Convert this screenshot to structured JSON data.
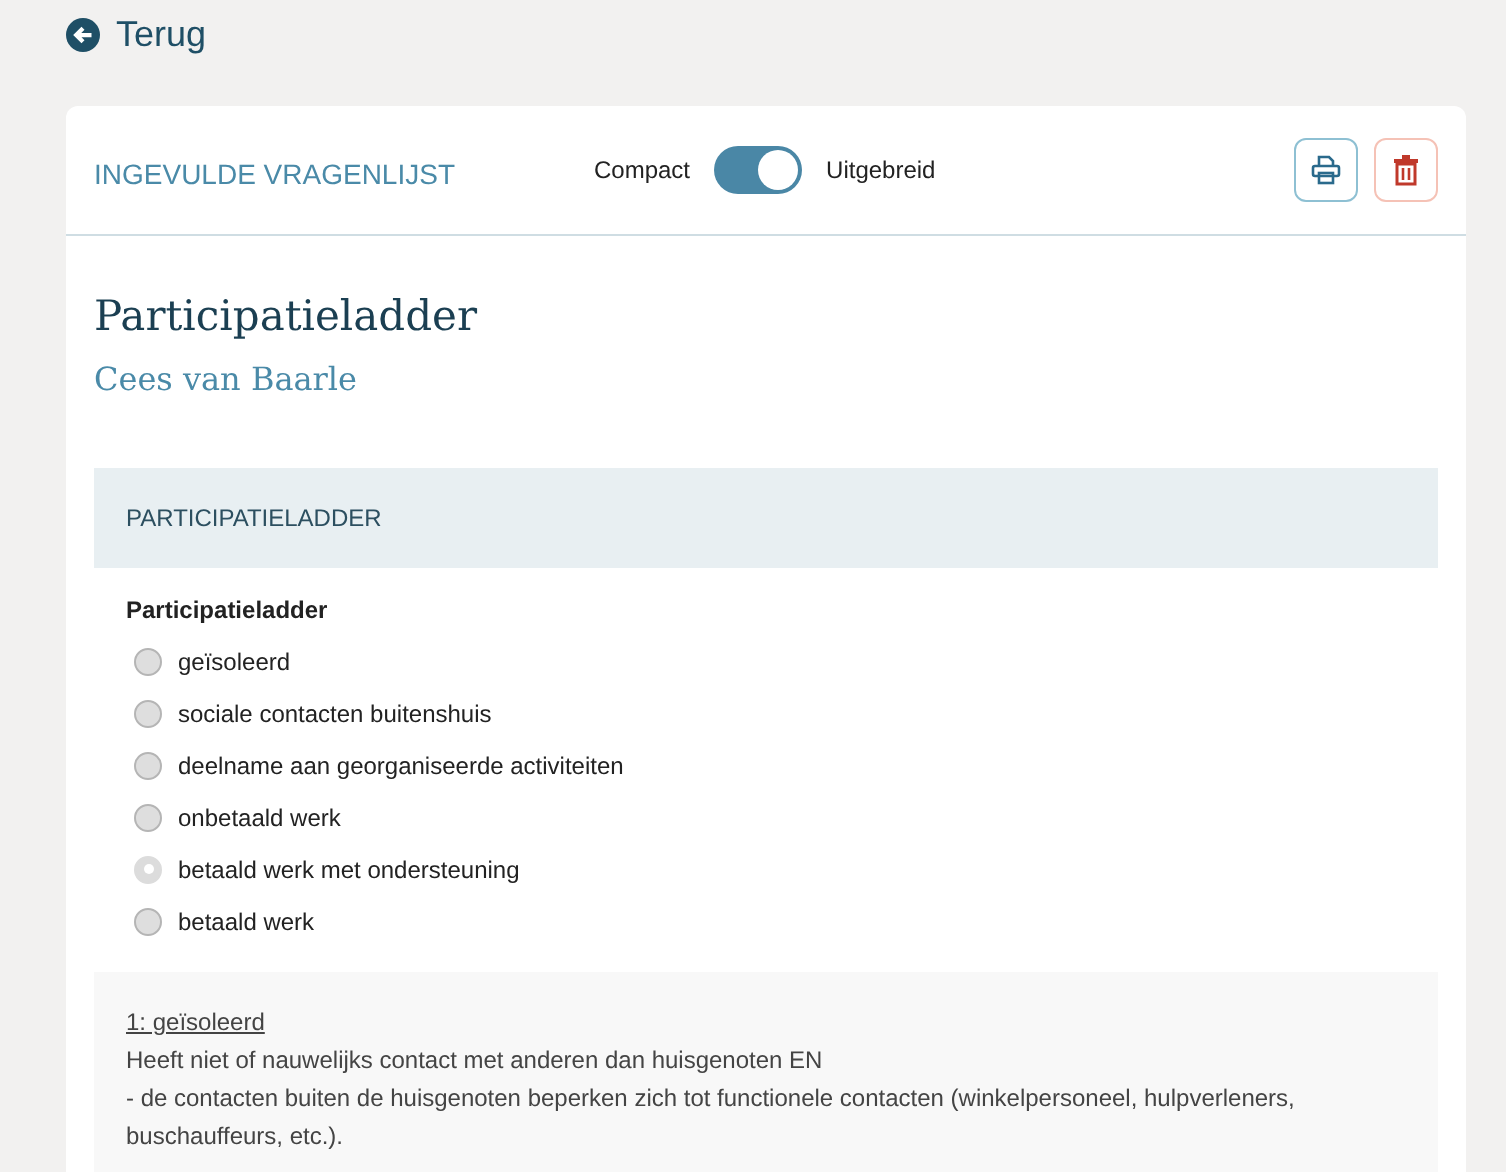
{
  "back_link": "Terug",
  "header": {
    "title": "INGEVULDE VRAGENLIJST",
    "toggle": {
      "left_label": "Compact",
      "right_label": "Uitgebreid",
      "on": true
    }
  },
  "title": "Participatieladder",
  "subtitle": "Cees van Baarle",
  "section": {
    "title": "PARTICIPATIELADDER",
    "question": "Participatieladder",
    "options": [
      {
        "label": "geïsoleerd",
        "selected": false
      },
      {
        "label": "sociale contacten buitenshuis",
        "selected": false
      },
      {
        "label": "deelname aan georganiseerde activiteiten",
        "selected": false
      },
      {
        "label": "onbetaald werk",
        "selected": false
      },
      {
        "label": "betaald werk met ondersteuning",
        "selected": true
      },
      {
        "label": "betaald werk",
        "selected": false
      }
    ],
    "info": {
      "heading": "1: geïsoleerd",
      "lines": [
        "Heeft niet of nauwelijks contact met anderen dan huisgenoten EN",
        "- de contacten buiten de huisgenoten beperken zich tot functionele contacten (winkelpersoneel, hulpverleners, buschauffeurs, etc.)."
      ]
    }
  }
}
